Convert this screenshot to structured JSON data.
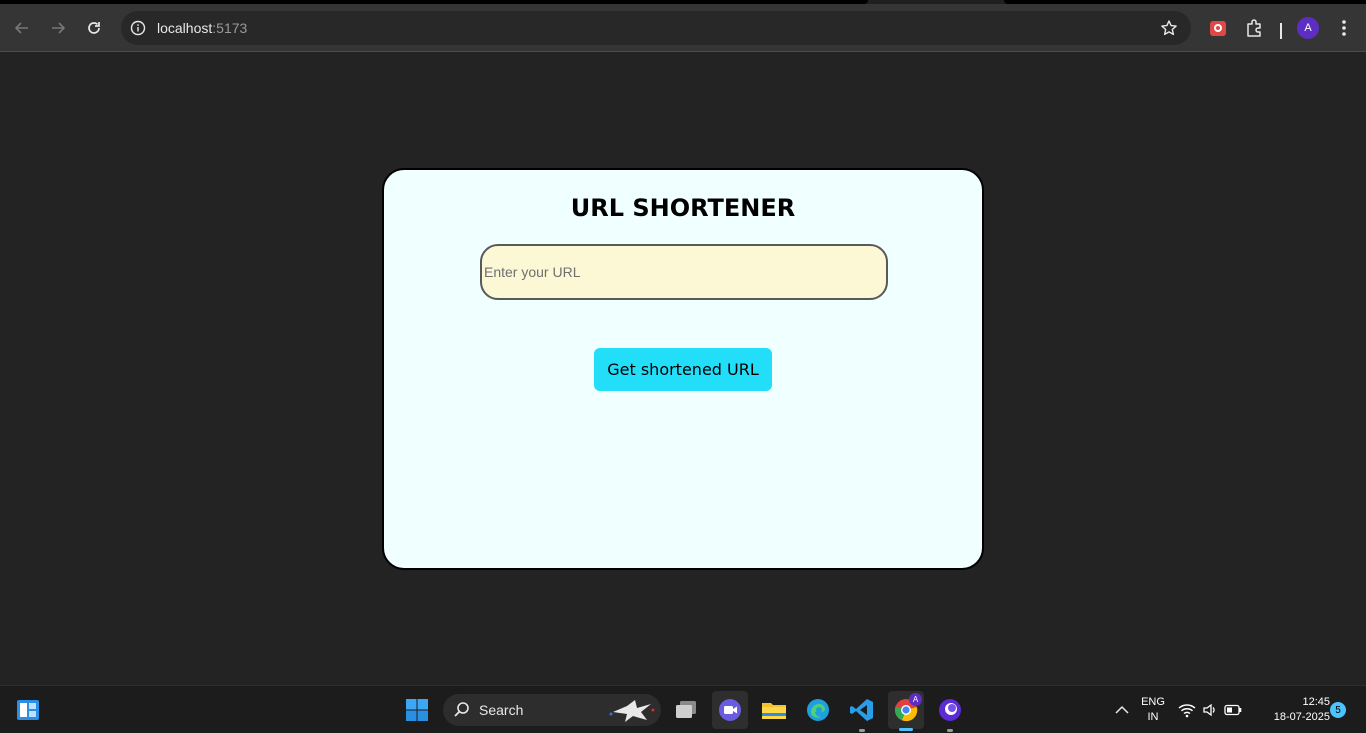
{
  "browser": {
    "address": {
      "host": "localhost",
      "port": ":5173"
    },
    "profile_initial": "A"
  },
  "page": {
    "title": "URL SHORTENER",
    "input_placeholder": "Enter your URL",
    "input_value": "",
    "submit_label": "Get shortened URL"
  },
  "taskbar": {
    "search_label": "Search",
    "language_line1": "ENG",
    "language_line2": "IN",
    "time": "12:45",
    "date": "18-07-2025",
    "notification_count": "5",
    "chrome_badge": "A"
  },
  "colors": {
    "page_bg": "#232323",
    "card_bg": "#f0ffff",
    "input_bg": "#fcf8d5",
    "button_bg": "#22def9"
  }
}
